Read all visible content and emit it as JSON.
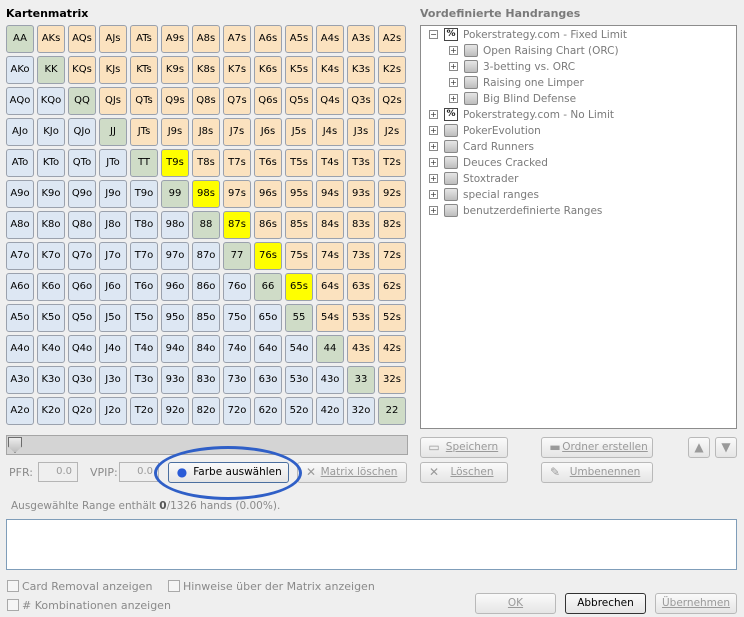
{
  "matrix": {
    "title": "Kartenmatrix",
    "rows": [
      [
        "AA",
        "AKs",
        "AQs",
        "AJs",
        "ATs",
        "A9s",
        "A8s",
        "A7s",
        "A6s",
        "A5s",
        "A4s",
        "A3s",
        "A2s"
      ],
      [
        "AKo",
        "KK",
        "KQs",
        "KJs",
        "KTs",
        "K9s",
        "K8s",
        "K7s",
        "K6s",
        "K5s",
        "K4s",
        "K3s",
        "K2s"
      ],
      [
        "AQo",
        "KQo",
        "QQ",
        "QJs",
        "QTs",
        "Q9s",
        "Q8s",
        "Q7s",
        "Q6s",
        "Q5s",
        "Q4s",
        "Q3s",
        "Q2s"
      ],
      [
        "AJo",
        "KJo",
        "QJo",
        "JJ",
        "JTs",
        "J9s",
        "J8s",
        "J7s",
        "J6s",
        "J5s",
        "J4s",
        "J3s",
        "J2s"
      ],
      [
        "ATo",
        "KTo",
        "QTo",
        "JTo",
        "TT",
        "T9s",
        "T8s",
        "T7s",
        "T6s",
        "T5s",
        "T4s",
        "T3s",
        "T2s"
      ],
      [
        "A9o",
        "K9o",
        "Q9o",
        "J9o",
        "T9o",
        "99",
        "98s",
        "97s",
        "96s",
        "95s",
        "94s",
        "93s",
        "92s"
      ],
      [
        "A8o",
        "K8o",
        "Q8o",
        "J8o",
        "T8o",
        "98o",
        "88",
        "87s",
        "86s",
        "85s",
        "84s",
        "83s",
        "82s"
      ],
      [
        "A7o",
        "K7o",
        "Q7o",
        "J7o",
        "T7o",
        "97o",
        "87o",
        "77",
        "76s",
        "75s",
        "74s",
        "73s",
        "72s"
      ],
      [
        "A6o",
        "K6o",
        "Q6o",
        "J6o",
        "T6o",
        "96o",
        "86o",
        "76o",
        "66",
        "65s",
        "64s",
        "63s",
        "62s"
      ],
      [
        "A5o",
        "K5o",
        "Q5o",
        "J5o",
        "T5o",
        "95o",
        "85o",
        "75o",
        "65o",
        "55",
        "54s",
        "53s",
        "52s"
      ],
      [
        "A4o",
        "K4o",
        "Q4o",
        "J4o",
        "T4o",
        "94o",
        "84o",
        "74o",
        "64o",
        "54o",
        "44",
        "43s",
        "42s"
      ],
      [
        "A3o",
        "K3o",
        "Q3o",
        "J3o",
        "T3o",
        "93o",
        "83o",
        "73o",
        "63o",
        "53o",
        "43o",
        "33",
        "32s"
      ],
      [
        "A2o",
        "K2o",
        "Q2o",
        "J2o",
        "T2o",
        "92o",
        "82o",
        "72o",
        "62o",
        "52o",
        "42o",
        "32o",
        "22"
      ]
    ],
    "selected": [
      "T9s",
      "98s",
      "87s",
      "76s",
      "65s"
    ],
    "colors": {
      "pair": "#cfdcc7",
      "suited": "#fbe2bf",
      "offsuit": "#dde7f3",
      "selected": "#ffff00"
    }
  },
  "controls": {
    "pfr_label": "PFR:",
    "pfr_value": "0.0",
    "vpip_label": "VPIP:",
    "vpip_value": "0.0",
    "color_button": "Farbe auswählen",
    "clear_button": "Matrix löschen",
    "summary_prefix": "Ausgewählte Range enthält ",
    "summary_count": "0",
    "summary_suffix": "/1326 hands (0.00%)."
  },
  "ranges": {
    "title": "Vordefinierte Handranges",
    "nodes": [
      {
        "label": "Pokerstrategy.com - Fixed Limit",
        "icon": "percent-icon",
        "expander": "−",
        "level": 0
      },
      {
        "label": "Open Raising Chart (ORC)",
        "icon": "folder-icon",
        "expander": "+",
        "level": 1
      },
      {
        "label": "3-betting vs. ORC",
        "icon": "folder-icon",
        "expander": "+",
        "level": 1
      },
      {
        "label": "Raising one Limper",
        "icon": "folder-icon",
        "expander": "+",
        "level": 1
      },
      {
        "label": "Big Blind Defense",
        "icon": "folder-icon",
        "expander": "+",
        "level": 1
      },
      {
        "label": "Pokerstrategy.com - No Limit",
        "icon": "percent-icon",
        "expander": "+",
        "level": 0
      },
      {
        "label": "PokerEvolution",
        "icon": "folder-icon",
        "expander": "+",
        "level": 0
      },
      {
        "label": "Card Runners",
        "icon": "folder-icon",
        "expander": "+",
        "level": 0
      },
      {
        "label": "Deuces Cracked",
        "icon": "folder-icon",
        "expander": "+",
        "level": 0
      },
      {
        "label": "Stoxtrader",
        "icon": "folder-icon",
        "expander": "+",
        "level": 0
      },
      {
        "label": "special ranges",
        "icon": "folder-icon",
        "expander": "+",
        "level": 0
      },
      {
        "label": "benutzerdefinierte Ranges",
        "icon": "user-folder-icon",
        "expander": "+",
        "level": 0
      }
    ],
    "save_button": "Speichern",
    "create_folder_button": "Ordner erstellen",
    "delete_button": "Löschen",
    "rename_button": "Umbenennen"
  },
  "options": {
    "card_removal": "Card Removal anzeigen",
    "hints": "Hinweise über der Matrix anzeigen",
    "combinations": "# Kombinationen anzeigen"
  },
  "footer": {
    "ok": "OK",
    "cancel": "Abbrechen",
    "apply": "Übernehmen"
  }
}
